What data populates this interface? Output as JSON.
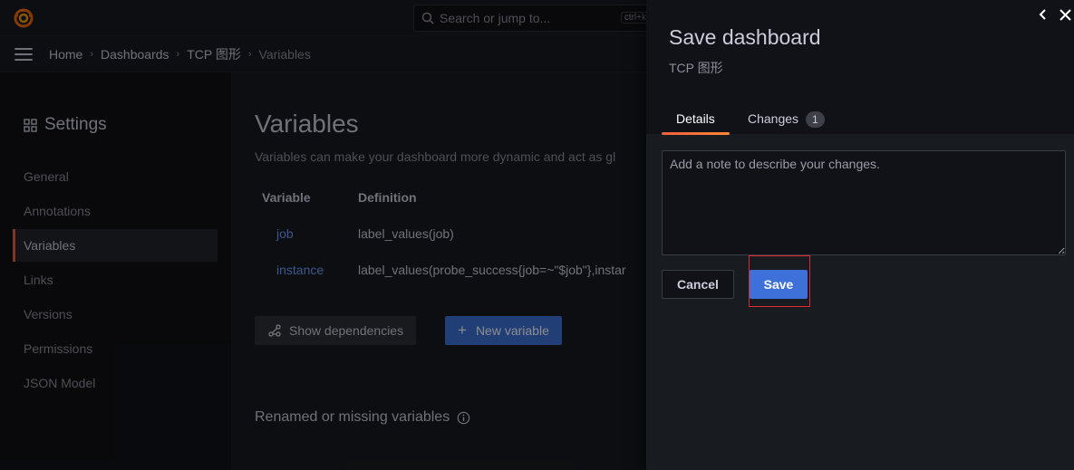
{
  "search": {
    "placeholder": "Search or jump to...",
    "shortcut": "ctrl+k"
  },
  "breadcrumb": [
    "Home",
    "Dashboards",
    "TCP 图形",
    "Variables"
  ],
  "sidebar": {
    "title": "Settings",
    "items": [
      {
        "label": "General",
        "active": false
      },
      {
        "label": "Annotations",
        "active": false
      },
      {
        "label": "Variables",
        "active": true
      },
      {
        "label": "Links",
        "active": false
      },
      {
        "label": "Versions",
        "active": false
      },
      {
        "label": "Permissions",
        "active": false
      },
      {
        "label": "JSON Model",
        "active": false
      }
    ]
  },
  "main": {
    "title": "Variables",
    "subtitle": "Variables can make your dashboard more dynamic and act as gl",
    "table": {
      "headers": [
        "Variable",
        "Definition"
      ],
      "rows": [
        {
          "name": "job",
          "definition": "label_values(job)"
        },
        {
          "name": "instance",
          "definition": "label_values(probe_success{job=~\"$job\"},instar"
        }
      ]
    },
    "show_dependencies_label": "Show dependencies",
    "new_variable_label": "New variable",
    "renamed_heading": "Renamed or missing variables"
  },
  "drawer": {
    "title": "Save dashboard",
    "subtitle": "TCP 图形",
    "tabs": [
      {
        "label": "Details",
        "active": true
      },
      {
        "label": "Changes",
        "count": "1",
        "active": false
      }
    ],
    "note_placeholder": "Add a note to describe your changes.",
    "cancel_label": "Cancel",
    "save_label": "Save"
  },
  "colors": {
    "accent_orange": "#f55f3e",
    "primary_blue": "#3d71d9",
    "link_blue": "#6e9fff",
    "highlight_red": "#e0262e"
  }
}
